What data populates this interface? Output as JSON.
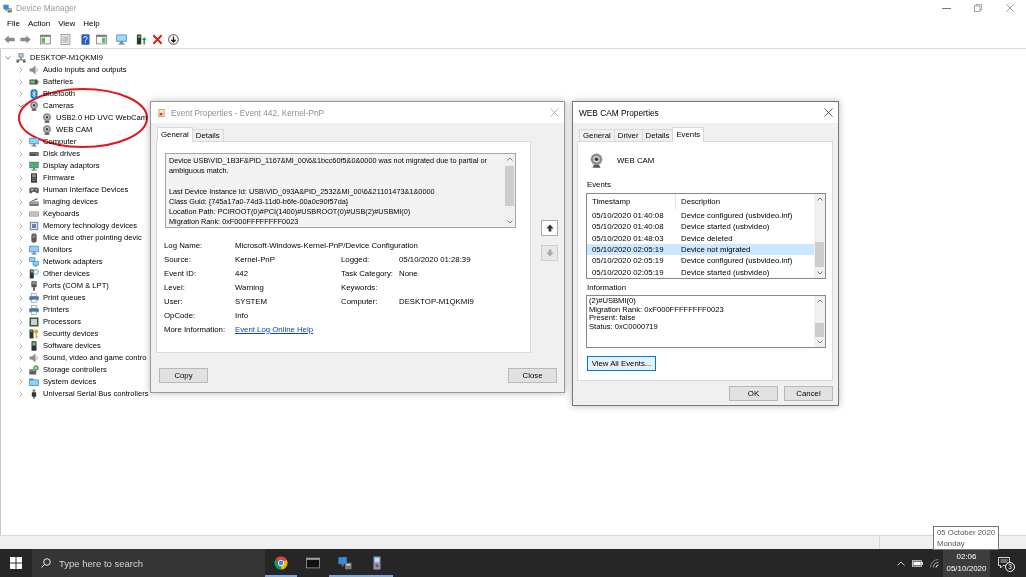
{
  "window": {
    "title": "Device Manager",
    "active": false
  },
  "menu": [
    "File",
    "Action",
    "View",
    "Help"
  ],
  "toolbar": [
    [
      {
        "kind": "back"
      },
      {
        "kind": "forward"
      }
    ],
    [
      {
        "kind": "pane"
      }
    ],
    [
      {
        "kind": "properties"
      }
    ],
    [
      {
        "kind": "help"
      },
      {
        "kind": "action-pane"
      }
    ],
    [
      {
        "kind": "scan"
      }
    ],
    [
      {
        "kind": "add"
      },
      {
        "kind": "uninstall"
      },
      {
        "kind": "disable"
      }
    ]
  ],
  "tree": {
    "label": "DESKTOP-M1QKMI9",
    "kind": "computer",
    "expanded": true,
    "children": [
      {
        "label": "Audio inputs and outputs",
        "kind": "speaker",
        "expanded": false
      },
      {
        "label": "Batteries",
        "kind": "battery",
        "expanded": false
      },
      {
        "label": "Bluetooth",
        "kind": "bluetooth",
        "expanded": false
      },
      {
        "label": "Cameras",
        "kind": "webcam",
        "expanded": true,
        "children": [
          {
            "label": "USB2.0 HD UVC WebCam",
            "kind": "webcam"
          },
          {
            "label": "WEB CAM",
            "kind": "webcam"
          }
        ]
      },
      {
        "label": "Computer",
        "kind": "monitor",
        "expanded": false
      },
      {
        "label": "Disk drives",
        "kind": "drive",
        "expanded": false
      },
      {
        "label": "Display adaptors",
        "kind": "display",
        "expanded": false
      },
      {
        "label": "Firmware",
        "kind": "board",
        "expanded": false
      },
      {
        "label": "Human Interface Devices",
        "kind": "gamepad",
        "expanded": false
      },
      {
        "label": "Imaging devices",
        "kind": "scanner",
        "expanded": false
      },
      {
        "label": "Keyboards",
        "kind": "keyboard",
        "expanded": false
      },
      {
        "label": "Memory technology devices",
        "kind": "memory",
        "expanded": false
      },
      {
        "label": "Mice and other pointing devic",
        "kind": "mouse",
        "expanded": false
      },
      {
        "label": "Monitors",
        "kind": "monitor",
        "expanded": false
      },
      {
        "label": "Network adapters",
        "kind": "network",
        "expanded": false
      },
      {
        "label": "Other devices",
        "kind": "unknown",
        "expanded": false
      },
      {
        "label": "Ports (COM & LPT)",
        "kind": "port",
        "expanded": false
      },
      {
        "label": "Print queues",
        "kind": "printer",
        "expanded": false
      },
      {
        "label": "Printers",
        "kind": "printer",
        "expanded": false
      },
      {
        "label": "Processors",
        "kind": "chip",
        "expanded": false
      },
      {
        "label": "Security devices",
        "kind": "key",
        "expanded": false
      },
      {
        "label": "Software devices",
        "kind": "device",
        "expanded": false
      },
      {
        "label": "Sound, video and game contro",
        "kind": "speaker",
        "expanded": false
      },
      {
        "label": "Storage controllers",
        "kind": "storage",
        "expanded": false
      },
      {
        "label": "System devices",
        "kind": "folder",
        "expanded": false
      },
      {
        "label": "Universal Serial Bus controllers",
        "kind": "usb",
        "expanded": false
      }
    ]
  },
  "event_dialog": {
    "title": "Event Properties - Event 442, Kernel-PnP",
    "active": false,
    "tabs": [
      {
        "label": "General",
        "selected": true
      },
      {
        "label": "Details",
        "selected": false
      }
    ],
    "message": [
      [
        "Device USB\\VID_1B3F&PID_1167&MI_00\\6&1bcc60f5&0&0000 was not migrated due to partial or ambiguous match."
      ],
      [
        "Last Device Instance Id: USB\\VID_093A&PID_2532&MI_00\\6&21101473&1&0000",
        "Class Guid: {745a17a0-74d3-11d0-b6fe-00a0c90f57da}",
        "Location Path: PCIROOT(0)#PCI(1400)#USBROOT(0)#USB(2)#USBMI(0)",
        "Migration Rank: 0xF000FFFFFFFF0023"
      ]
    ],
    "fields": [
      [
        {
          "label": "Log Name:",
          "value": "Microsoft-Windows-Kernel-PnP/Device Configuration",
          "kind": "text"
        }
      ],
      [
        {
          "label": "Source:",
          "value": "Kernel-PnP",
          "kind": "text"
        },
        {
          "label": "Logged:",
          "value": "05/10/2020 01:28:39",
          "kind": "text"
        }
      ],
      [
        {
          "label": "Event ID:",
          "value": "442",
          "kind": "text"
        },
        {
          "label": "Task Category:",
          "value": "None",
          "kind": "text"
        }
      ],
      [
        {
          "label": "Level:",
          "value": "Warning",
          "kind": "text"
        },
        {
          "label": "Keywords:"
        }
      ],
      [
        {
          "label": "User:",
          "value": "SYSTEM",
          "kind": "text"
        },
        {
          "label": "Computer:",
          "value": "DESKTOP-M1QKMI9",
          "kind": "text"
        }
      ],
      [
        {
          "label": "OpCode:",
          "value": "Info",
          "kind": "text"
        }
      ],
      [
        {
          "label": "More Information:",
          "value": "Event Log Online Help",
          "kind": "link"
        }
      ]
    ],
    "nav": [
      {
        "kind": "up",
        "disabled": false
      },
      {
        "kind": "down",
        "disabled": true
      }
    ],
    "buttons": [
      "Copy",
      "Close"
    ]
  },
  "props_dialog": {
    "title": "WEB CAM Properties",
    "active": true,
    "tabs": [
      {
        "label": "General",
        "selected": false
      },
      {
        "label": "Driver",
        "selected": false
      },
      {
        "label": "Details",
        "selected": false
      },
      {
        "label": "Events",
        "selected": true
      }
    ],
    "device_name": "WEB CAM",
    "events_label": "Events",
    "events": {
      "columns": [
        "Timestamp",
        "Description"
      ],
      "rows": [
        {
          "cells": [
            "05/10/2020 01:40:08",
            "Device configured (usbvideo.inf)"
          ],
          "selected": false
        },
        {
          "cells": [
            "05/10/2020 01:40:08",
            "Device started (usbvideo)"
          ],
          "selected": false
        },
        {
          "cells": [
            "05/10/2020 01:48:03",
            "Device deleted"
          ],
          "selected": false
        },
        {
          "cells": [
            "05/10/2020 02:05:19",
            "Device not migrated"
          ],
          "selected": true
        },
        {
          "cells": [
            "05/10/2020 02:05:19",
            "Device configured (usbvideo.inf)"
          ],
          "selected": false
        },
        {
          "cells": [
            "05/10/2020 02:05:19",
            "Device started (usbvideo)"
          ],
          "selected": false
        }
      ]
    },
    "information_label": "Information",
    "information": [
      "(2)#USBMI(0)",
      "Migration Rank: 0xF000FFFFFFFF0023",
      "Present: false",
      "Status: 0xC0000719"
    ],
    "view_all": {
      "label": "View All Events...",
      "focused": true
    },
    "buttons": [
      "OK",
      "Cancel"
    ]
  },
  "tooltip": {
    "lines": [
      "05 October 2020",
      "Monday"
    ]
  },
  "taskbar": {
    "search_placeholder": "Type here to search",
    "apps": [
      {
        "kind": "browser",
        "running": true
      },
      {
        "kind": "terminal",
        "running": false
      },
      {
        "kind": "device-manager",
        "running": true
      },
      {
        "kind": "tool",
        "running": true
      }
    ],
    "clock": {
      "time": "02:06",
      "date": "05/10/2020",
      "highlighted": true
    },
    "notification_count": "3"
  }
}
